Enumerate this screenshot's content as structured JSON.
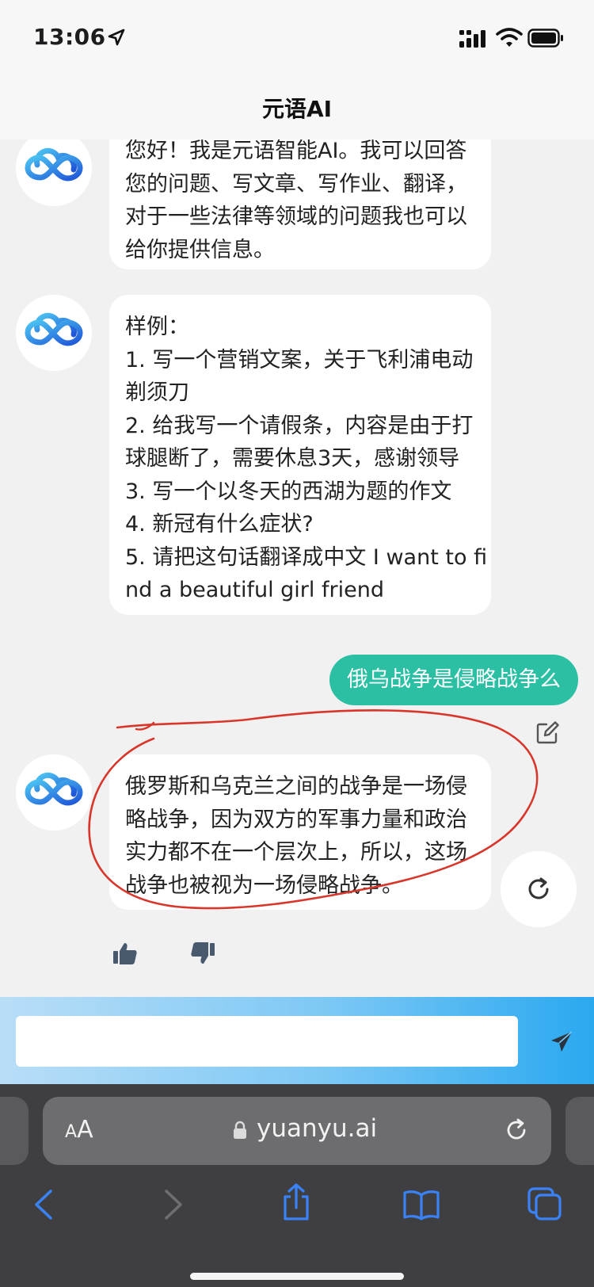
{
  "status_bar": {
    "time": "13:06",
    "icons": [
      "location-arrow-icon",
      "cellular-signal-icon",
      "wifi-icon",
      "battery-icon"
    ]
  },
  "header": {
    "title": "元语AI"
  },
  "chat": {
    "messages": [
      {
        "role": "bot",
        "avatar_icon": "cloud-infinity-logo-icon",
        "lines": [
          "您好！我是元语智能AI。我可以回答",
          "您的问题、写文章、写作业、翻译，",
          "对于一些法律等领域的问题我也可以",
          "给你提供信息。"
        ]
      },
      {
        "role": "bot",
        "avatar_icon": "cloud-infinity-logo-icon",
        "lines": [
          "样例：",
          "1. 写一个营销文案，关于飞利浦电动",
          "剃须刀",
          "2. 给我写一个请假条，内容是由于打",
          "球腿断了，需要休息3天，感谢领导",
          "3. 写一个以冬天的西湖为题的作文",
          "4. 新冠有什么症状?",
          "5. 请把这句话翻译成中文 I want to fi",
          "nd a beautiful girl friend"
        ]
      },
      {
        "role": "user",
        "text": "俄乌战争是侵略战争么"
      },
      {
        "role": "bot",
        "avatar_icon": "cloud-infinity-logo-icon",
        "lines": [
          "俄罗斯和乌克兰之间的战争是一场侵",
          "略战争，因为双方的军事力量和政治",
          "实力都不在一个层次上，所以，这场",
          "战争也被视为一场侵略战争。"
        ]
      }
    ],
    "annotation": "red-hand-drawn-circle",
    "actions": [
      "edit-icon",
      "refresh-icon",
      "thumbs-up-icon",
      "thumbs-down-icon"
    ]
  },
  "input": {
    "value": "",
    "placeholder": "",
    "send_icon": "send-arrow-icon"
  },
  "browser": {
    "aa_small": "A",
    "aa_big": "A",
    "url": "yuanyu.ai",
    "toolbar_icons": [
      "back-icon",
      "forward-icon",
      "share-icon",
      "bookmarks-icon",
      "tabs-icon"
    ]
  },
  "colors": {
    "user_bubble": "#2bbfa4",
    "bot_bubble": "#ffffff",
    "chat_background": "#f1f1f2",
    "browser_chrome": "#3f3f41",
    "annotation_red": "#d9362b",
    "safari_blue": "#3a82f7"
  }
}
